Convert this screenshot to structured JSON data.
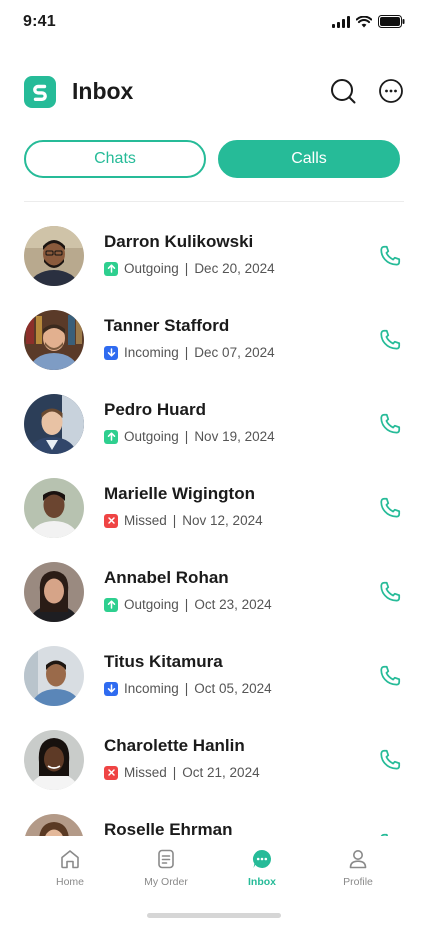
{
  "status_bar": {
    "time": "9:41"
  },
  "header": {
    "title": "Inbox"
  },
  "tabs": [
    {
      "label": "Chats",
      "active": false
    },
    {
      "label": "Calls",
      "active": true
    }
  ],
  "colors": {
    "accent": "#26bb98",
    "outgoing": "#2ecf8f",
    "incoming": "#2f6bf0",
    "missed": "#ef4444"
  },
  "calls": [
    {
      "name": "Darron Kulikowski",
      "type": "Outgoing",
      "date": "Dec 20, 2024",
      "icon": "arrow-up-icon"
    },
    {
      "name": "Tanner Stafford",
      "type": "Incoming",
      "date": "Dec 07, 2024",
      "icon": "arrow-down-icon"
    },
    {
      "name": "Pedro Huard",
      "type": "Outgoing",
      "date": "Nov 19, 2024",
      "icon": "arrow-up-icon"
    },
    {
      "name": "Marielle Wigington",
      "type": "Missed",
      "date": "Nov 12, 2024",
      "icon": "x-icon"
    },
    {
      "name": "Annabel Rohan",
      "type": "Outgoing",
      "date": "Oct 23, 2024",
      "icon": "arrow-up-icon"
    },
    {
      "name": "Titus Kitamura",
      "type": "Incoming",
      "date": "Oct 05, 2024",
      "icon": "arrow-down-icon"
    },
    {
      "name": "Charolette Hanlin",
      "type": "Missed",
      "date": "Oct 21, 2024",
      "icon": "x-icon"
    },
    {
      "name": "Roselle Ehrman",
      "type": "",
      "date": "",
      "icon": ""
    }
  ],
  "bottom_nav": [
    {
      "label": "Home",
      "icon": "home-icon",
      "active": false
    },
    {
      "label": "My Order",
      "icon": "order-icon",
      "active": false
    },
    {
      "label": "Inbox",
      "icon": "chat-icon",
      "active": true
    },
    {
      "label": "Profile",
      "icon": "profile-icon",
      "active": false
    }
  ]
}
